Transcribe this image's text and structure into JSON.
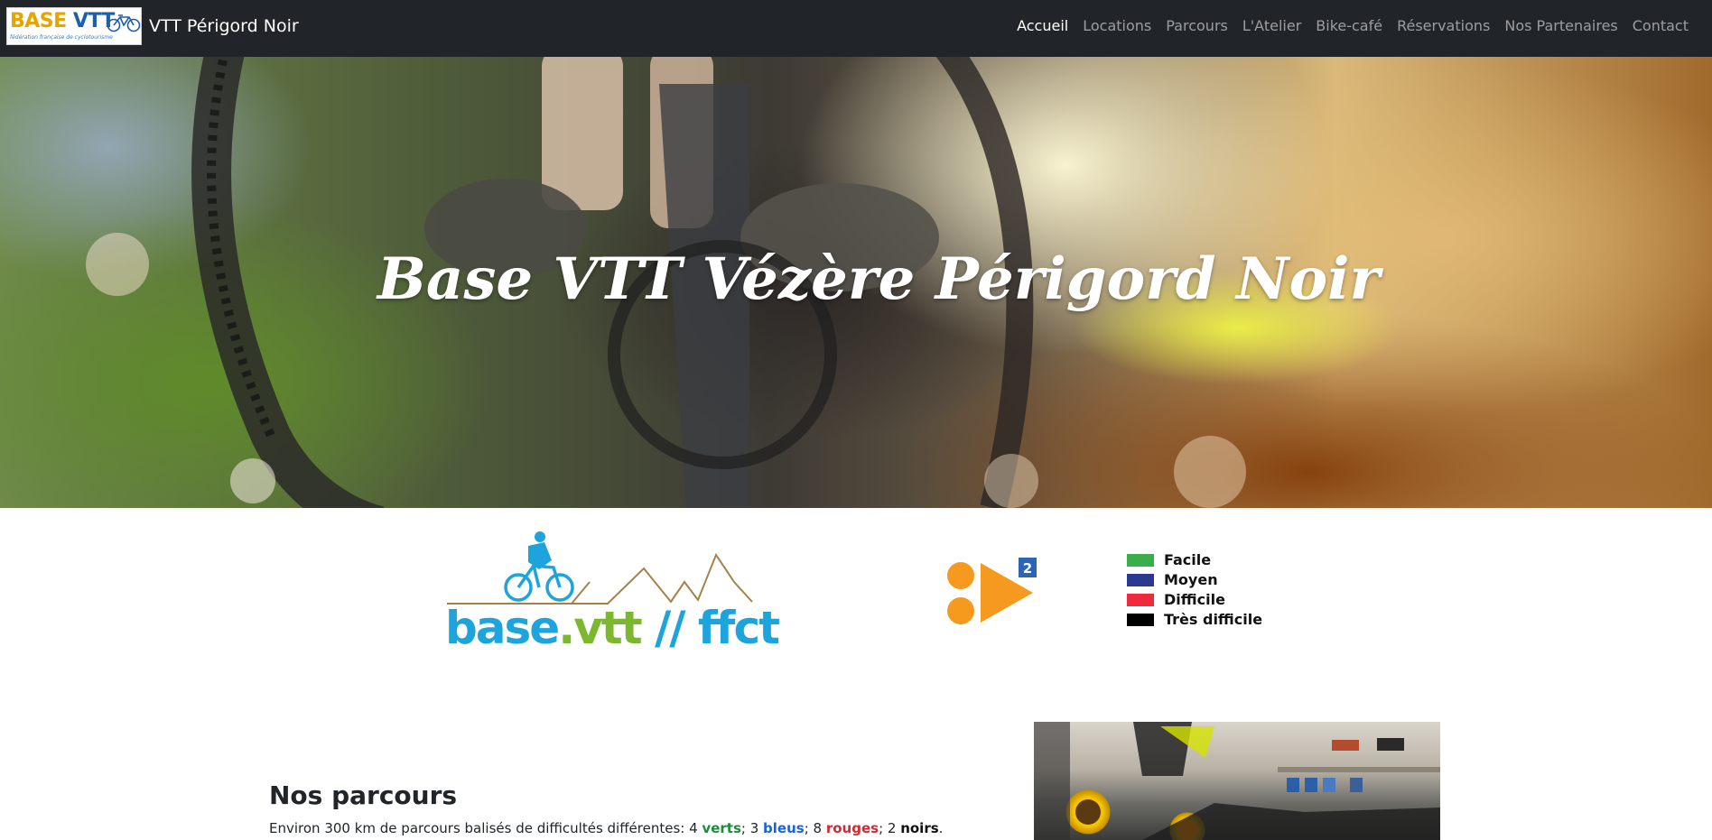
{
  "header": {
    "logo": {
      "word_part1": "BASE",
      "word_part2": "VTT",
      "tagline": "fédération française de cyclotourisme"
    },
    "brand_text": "VTT Périgord Noir",
    "nav": [
      {
        "label": "Accueil",
        "active": true
      },
      {
        "label": "Locations",
        "active": false
      },
      {
        "label": "Parcours",
        "active": false
      },
      {
        "label": "L'Atelier",
        "active": false
      },
      {
        "label": "Bike-café",
        "active": false
      },
      {
        "label": "Réservations",
        "active": false
      },
      {
        "label": "Nos Partenaires",
        "active": false
      },
      {
        "label": "Contact",
        "active": false
      }
    ]
  },
  "hero": {
    "title": "Base VTT Vézère Périgord Noir"
  },
  "logos": {
    "ffct": {
      "part1": "base",
      "part2": ".vtt",
      "part3": " // ffct"
    },
    "level": {
      "badge": "2"
    }
  },
  "legend": [
    {
      "label": "Facile",
      "color": "#3aae4a"
    },
    {
      "label": "Moyen",
      "color": "#2b3990"
    },
    {
      "label": "Difficile",
      "color": "#ee2a3c"
    },
    {
      "label": "Très difficile",
      "color": "#000000"
    }
  ],
  "parcours": {
    "title": "Nos parcours",
    "text_prefix": "Environ 300 km de parcours balisés de difficultés différentes: 4 ",
    "verts": "verts",
    "sep1": "; 3 ",
    "bleus": "bleus",
    "sep2": "; 8 ",
    "rouges": "rouges",
    "sep3": "; 2 ",
    "noirs": "noirs",
    "suffix": "."
  },
  "colors": {
    "navbar": "#212529",
    "link_inactive": "rgba(255,255,255,0.55)",
    "link_active": "#ffffff",
    "ffct_blue": "#1ea4dc",
    "ffct_green": "#7cb82f",
    "mountain_line": "#a4824a",
    "level_orange": "#f59a1f",
    "level_badge": "#2b65b3"
  }
}
